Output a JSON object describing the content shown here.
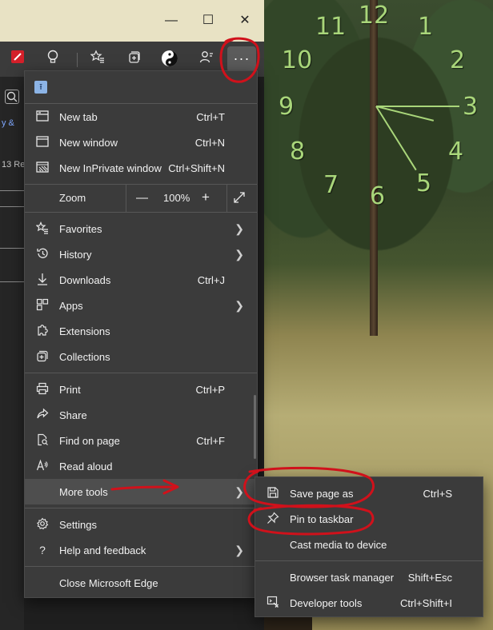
{
  "window": {
    "minimize_glyph": "—",
    "maximize_glyph": "☐",
    "close_glyph": "✕"
  },
  "page_fragments": {
    "link_fragment": "y &",
    "text_fragment": "13 Re"
  },
  "clock": {
    "numbers": [
      "12",
      "1",
      "2",
      "3",
      "4",
      "5",
      "6",
      "7",
      "8",
      "9",
      "10",
      "11"
    ]
  },
  "menu": {
    "new_tab": {
      "label": "New tab",
      "shortcut": "Ctrl+T"
    },
    "new_window": {
      "label": "New window",
      "shortcut": "Ctrl+N"
    },
    "new_inprivate": {
      "label": "New InPrivate window",
      "shortcut": "Ctrl+Shift+N"
    },
    "zoom": {
      "label": "Zoom",
      "minus": "—",
      "value": "100%",
      "plus": "+"
    },
    "favorites": {
      "label": "Favorites"
    },
    "history": {
      "label": "History"
    },
    "downloads": {
      "label": "Downloads",
      "shortcut": "Ctrl+J"
    },
    "apps": {
      "label": "Apps"
    },
    "extensions": {
      "label": "Extensions"
    },
    "collections": {
      "label": "Collections"
    },
    "print": {
      "label": "Print",
      "shortcut": "Ctrl+P"
    },
    "share": {
      "label": "Share"
    },
    "find": {
      "label": "Find on page",
      "shortcut": "Ctrl+F"
    },
    "read_aloud": {
      "label": "Read aloud"
    },
    "more_tools": {
      "label": "More tools"
    },
    "settings": {
      "label": "Settings"
    },
    "help": {
      "label": "Help and feedback"
    },
    "close": {
      "label": "Close Microsoft Edge"
    }
  },
  "submenu": {
    "save_page": {
      "label": "Save page as",
      "shortcut": "Ctrl+S"
    },
    "pin_taskbar": {
      "label": "Pin to taskbar"
    },
    "cast": {
      "label": "Cast media to device"
    },
    "task_manager": {
      "label": "Browser task manager",
      "shortcut": "Shift+Esc"
    },
    "dev_tools": {
      "label": "Developer tools",
      "shortcut": "Ctrl+Shift+I"
    }
  },
  "colors": {
    "menu_bg": "#3b3b3b",
    "annotation_red": "#d0111b",
    "clock_green": "#a9d67a"
  }
}
